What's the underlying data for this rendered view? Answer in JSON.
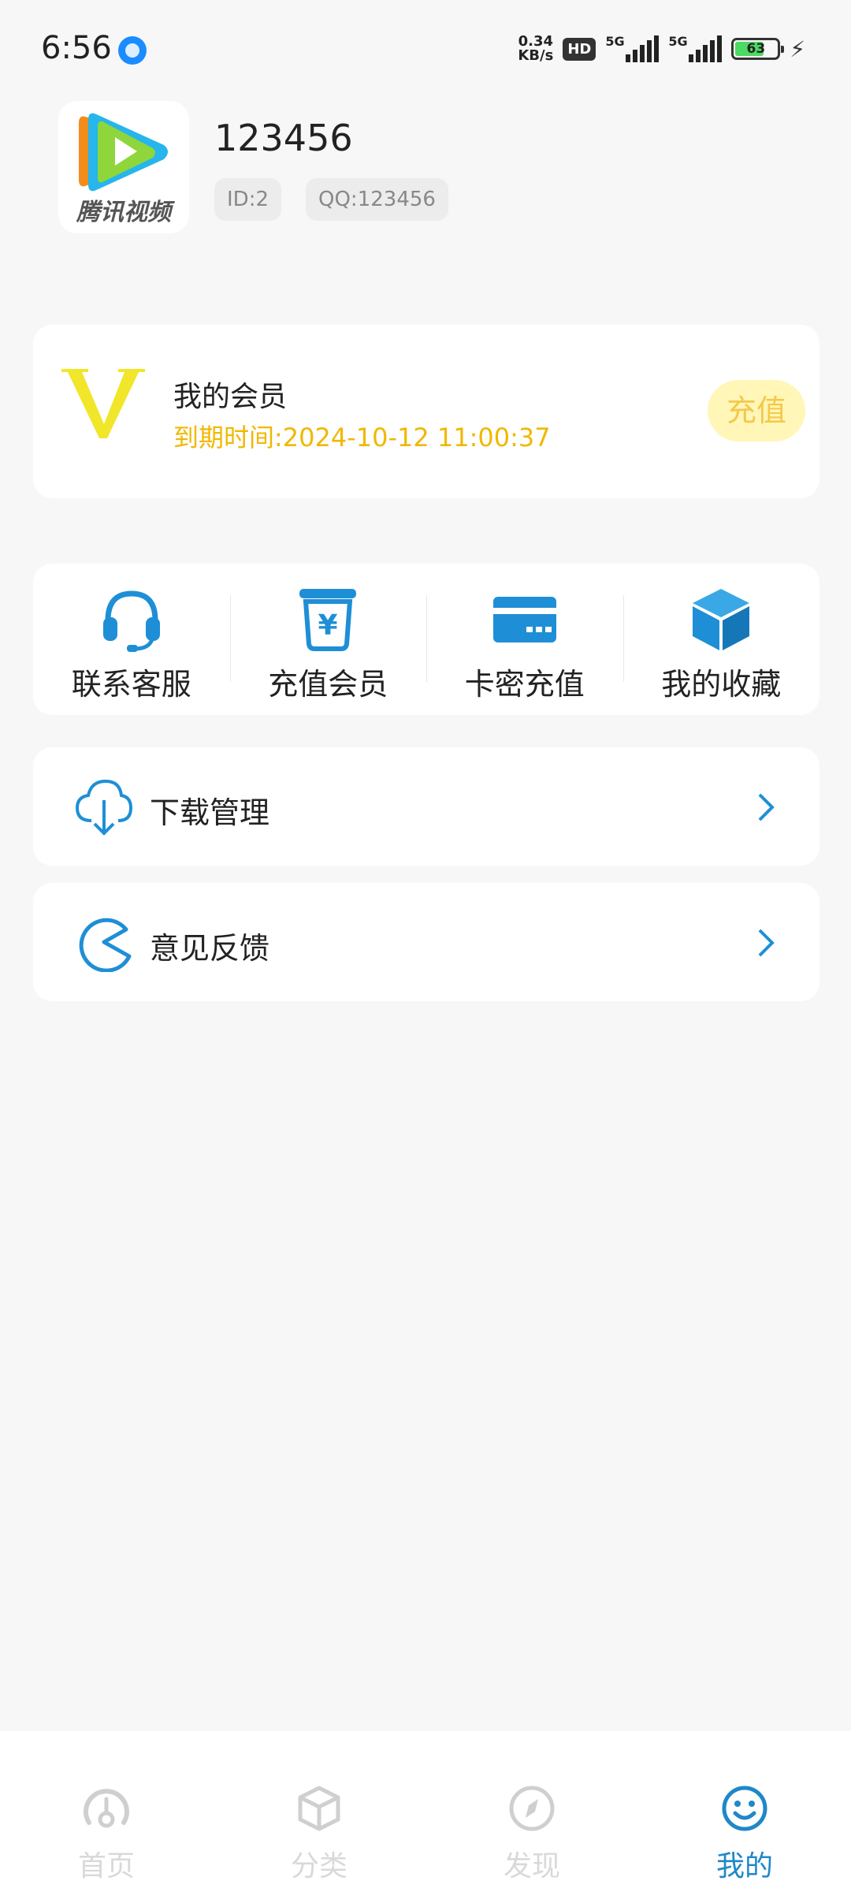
{
  "status_bar": {
    "time": "6:56",
    "net_speed_value": "0.34",
    "net_speed_unit": "KB/s",
    "hd_label": "HD",
    "sim1_label": "5G",
    "sim2_label": "5G",
    "battery_level": "63"
  },
  "profile": {
    "avatar_brand": "腾讯视频",
    "username": "123456",
    "id_tag": "ID:2",
    "qq_tag": "QQ:123456"
  },
  "vip_card": {
    "title": "我的会员",
    "expiry": "到期时间:2024-10-12 11:00:37",
    "recharge_label": "充值",
    "accent_color": "#f0b800"
  },
  "quick_actions": [
    {
      "label": "联系客服",
      "icon": "headset-icon"
    },
    {
      "label": "充值会员",
      "icon": "yuan-bag-icon"
    },
    {
      "label": "卡密充值",
      "icon": "card-icon"
    },
    {
      "label": "我的收藏",
      "icon": "cube-icon"
    }
  ],
  "menu": {
    "download_label": "下载管理",
    "feedback_label": "意见反馈"
  },
  "bottom_nav": {
    "items": [
      {
        "label": "首页",
        "icon": "home-dial-icon",
        "active": false
      },
      {
        "label": "分类",
        "icon": "box-icon",
        "active": false
      },
      {
        "label": "发现",
        "icon": "compass-icon",
        "active": false
      },
      {
        "label": "我的",
        "icon": "smiley-icon",
        "active": true
      }
    ],
    "active_color": "#1e88c8"
  },
  "theme": {
    "icon_blue": "#1e8fd6",
    "background": "#f7f7f7"
  }
}
